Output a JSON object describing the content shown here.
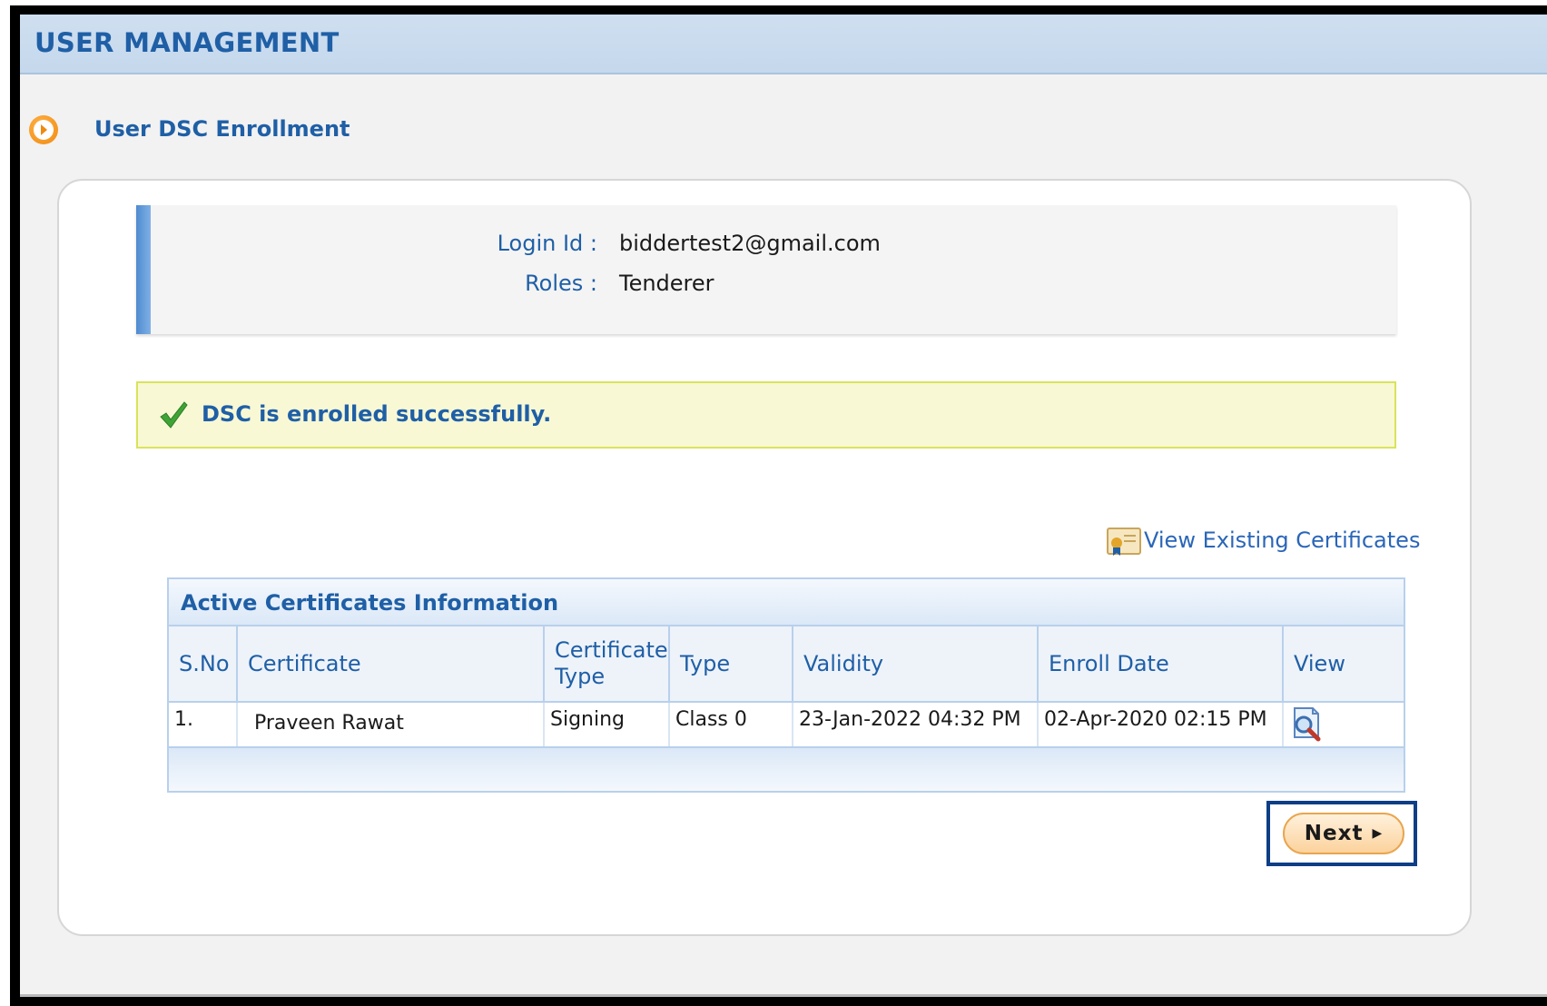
{
  "header": {
    "title": "USER MANAGEMENT"
  },
  "section": {
    "title": "User DSC Enrollment"
  },
  "user_info": {
    "login_label": "Login Id :",
    "login_value": "biddertest2@gmail.com",
    "roles_label": "Roles :",
    "roles_value": "Tenderer"
  },
  "message": {
    "success": "DSC is enrolled successfully."
  },
  "links": {
    "view_existing": "View Existing Certificates"
  },
  "table": {
    "caption": "Active Certificates Information",
    "columns": [
      "S.No",
      "Certificate",
      "Certificate Type",
      "Type",
      "Validity",
      "Enroll Date",
      "View"
    ],
    "rows": [
      [
        "1.",
        "Praveen Rawat",
        "Signing",
        "Class 0",
        "23-Jan-2022 04:32 PM",
        "02-Apr-2020 02:15 PM"
      ]
    ]
  },
  "buttons": {
    "next": "Next"
  },
  "colors": {
    "accent_blue": "#1f5fa6",
    "success_bg": "#f8f8d5",
    "next_bg": "#fbd29c",
    "highlight_outline": "#0e3e86"
  }
}
